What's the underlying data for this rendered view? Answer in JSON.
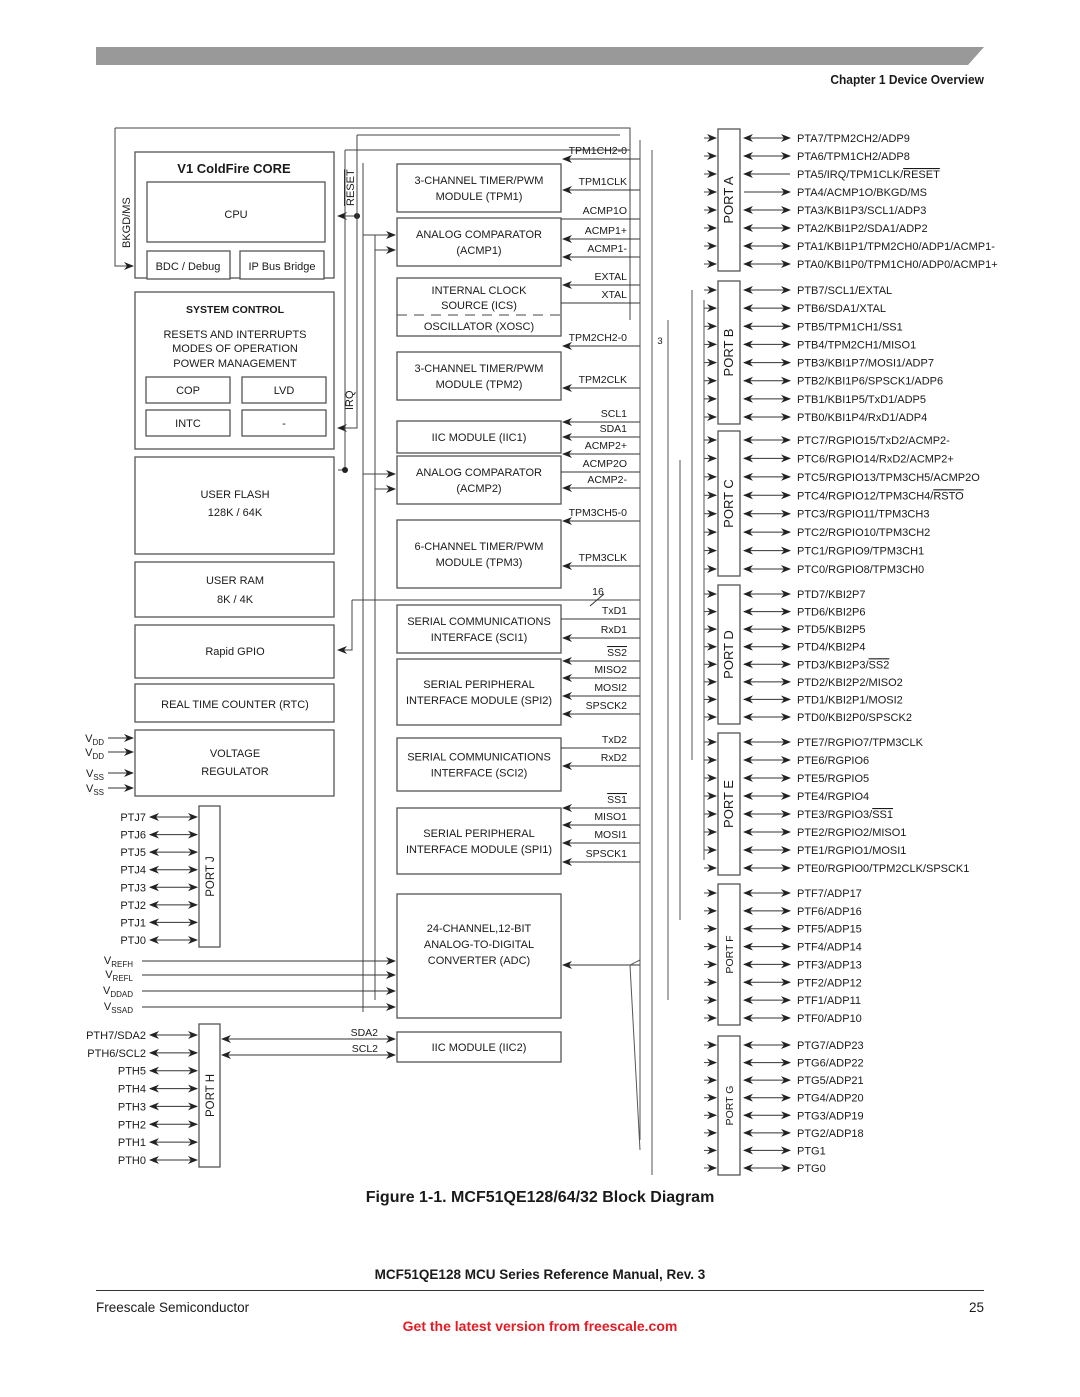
{
  "header": {
    "chapter": "Chapter 1 Device Overview"
  },
  "core": {
    "title": "V1 ColdFire CORE",
    "cpu": "CPU",
    "bdc": "BDC / Debug",
    "ip_bus": "IP Bus Bridge",
    "bkgd_signal": "BKGD/MS",
    "reset_signal": "RESET",
    "irq_signal": "IRQ"
  },
  "system_control": {
    "title": "SYSTEM CONTROL",
    "lines": [
      "RESETS AND INTERRUPTS",
      "MODES OF OPERATION",
      "POWER MANAGEMENT"
    ],
    "cop": "COP",
    "lvd": "LVD",
    "intc": "INTC",
    "blank": "-"
  },
  "memory": {
    "flash_title": "USER FLASH",
    "flash_size": "128K / 64K",
    "ram_title": "USER RAM",
    "ram_size": "8K / 4K",
    "rgpio": "Rapid GPIO",
    "rtc": "REAL TIME COUNTER (RTC)"
  },
  "regulator": {
    "line1": "VOLTAGE",
    "line2": "REGULATOR",
    "pins": [
      {
        "main": "V",
        "sub": "DD"
      },
      {
        "main": "V",
        "sub": "DD"
      },
      {
        "main": "V",
        "sub": "SS"
      },
      {
        "main": "V",
        "sub": "SS"
      }
    ]
  },
  "adc_refs": [
    {
      "main": "V",
      "sub": "REFH"
    },
    {
      "main": "V",
      "sub": "REFL"
    },
    {
      "main": "V",
      "sub": "DDAD"
    },
    {
      "main": "V",
      "sub": "SSAD"
    }
  ],
  "modules": {
    "tpm1": [
      "3-CHANNEL TIMER/PWM",
      "MODULE (TPM1)"
    ],
    "acmp1": [
      "ANALOG COMPARATOR",
      "(ACMP1)"
    ],
    "ics": [
      "INTERNAL CLOCK",
      "SOURCE (ICS)",
      "OSCILLATOR (XOSC)"
    ],
    "tpm2": [
      "3-CHANNEL TIMER/PWM",
      "MODULE (TPM2)"
    ],
    "iic1": [
      "IIC MODULE (IIC1)"
    ],
    "acmp2": [
      "ANALOG COMPARATOR",
      "(ACMP2)"
    ],
    "tpm3": [
      "6-CHANNEL TIMER/PWM",
      "MODULE (TPM3)"
    ],
    "sci1": [
      "SERIAL COMMUNICATIONS",
      "INTERFACE (SCI1)"
    ],
    "spi2": [
      "SERIAL PERIPHERAL",
      "INTERFACE MODULE (SPI2)"
    ],
    "sci2": [
      "SERIAL COMMUNICATIONS",
      "INTERFACE (SCI2)"
    ],
    "spi1": [
      "SERIAL PERIPHERAL",
      "INTERFACE MODULE (SPI1)"
    ],
    "adc": [
      "24-CHANNEL,12-BIT",
      "ANALOG-TO-DIGITAL",
      "CONVERTER (ADC)"
    ],
    "iic2": [
      "IIC MODULE (IIC2)"
    ]
  },
  "signals": {
    "tpm1": [
      "TPM1CH2-0",
      "TPM1CLK"
    ],
    "acmp1": [
      "ACMP1O",
      "ACMP1+",
      "ACMP1-"
    ],
    "ics": [
      "EXTAL",
      "XTAL"
    ],
    "tpm2": [
      "TPM2CH2-0",
      "TPM2CLK"
    ],
    "iic1": [
      "SCL1",
      "SDA1"
    ],
    "acmp2": [
      "ACMP2+",
      "ACMP2O",
      "ACMP2-"
    ],
    "tpm3": [
      "TPM3CH5-0",
      "TPM3CLK"
    ],
    "bus16": "16",
    "bus3": "3",
    "sci1": [
      "TxD1",
      "RxD1"
    ],
    "spi2": [
      "SS2",
      "MISO2",
      "MOSI2",
      "SPSCK2"
    ],
    "sci2": [
      "TxD2",
      "RxD2"
    ],
    "spi1": [
      "SS1",
      "MISO1",
      "MOSI1",
      "SPSCK1"
    ],
    "iic2": [
      "SDA2",
      "SCL2"
    ]
  },
  "ports_right": [
    {
      "name": "PORT A",
      "pins": [
        "PTA7/TPM2CH2/ADP9",
        "PTA6/TPM1CH2/ADP8",
        "PTA5/IRQ/TPM1CLK/RESET",
        "PTA4/ACMP1O/BKGD/MS",
        "PTA3/KBI1P3/SCL1/ADP3",
        "PTA2/KBI1P2/SDA1/ADP2",
        "PTA1/KBI1P1/TPM2CH0/ADP1/ACMP1-",
        "PTA0/KBI1P0/TPM1CH0/ADP0/ACMP1+"
      ]
    },
    {
      "name": "PORT B",
      "pins": [
        "PTB7/SCL1/EXTAL",
        "PTB6/SDA1/XTAL",
        "PTB5/TPM1CH1/SS1",
        "PTB4/TPM2CH1/MISO1",
        "PTB3/KBI1P7/MOSI1/ADP7",
        "PTB2/KBI1P6/SPSCK1/ADP6",
        "PTB1/KBI1P5/TxD1/ADP5",
        "PTB0/KBI1P4/RxD1/ADP4"
      ]
    },
    {
      "name": "PORT C",
      "pins": [
        "PTC7/RGPIO15/TxD2/ACMP2-",
        "PTC6/RGPIO14/RxD2/ACMP2+",
        "PTC5/RGPIO13/TPM3CH5/ACMP2O",
        "PTC4/RGPIO12/TPM3CH4/RSTO",
        "PTC3/RGPIO11/TPM3CH3",
        "PTC2/RGPIO10/TPM3CH2",
        "PTC1/RGPIO9/TPM3CH1",
        "PTC0/RGPIO8/TPM3CH0"
      ]
    },
    {
      "name": "PORT D",
      "pins": [
        "PTD7/KBI2P7",
        "PTD6/KBI2P6",
        "PTD5/KBI2P5",
        "PTD4/KBI2P4",
        "PTD3/KBI2P3/SS2",
        "PTD2/KBI2P2/MISO2",
        "PTD1/KBI2P1/MOSI2",
        "PTD0/KBI2P0/SPSCK2"
      ]
    },
    {
      "name": "PORT E",
      "pins": [
        "PTE7/RGPIO7/TPM3CLK",
        "PTE6/RGPIO6",
        "PTE5/RGPIO5",
        "PTE4/RGPIO4",
        "PTE3/RGPIO3/SS1",
        "PTE2/RGPIO2/MISO1",
        "PTE1/RGPIO1/MOSI1",
        "PTE0/RGPIO0/TPM2CLK/SPSCK1"
      ]
    },
    {
      "name": "PORT F",
      "pins": [
        "PTF7/ADP17",
        "PTF6/ADP16",
        "PTF5/ADP15",
        "PTF4/ADP14",
        "PTF3/ADP13",
        "PTF2/ADP12",
        "PTF1/ADP11",
        "PTF0/ADP10"
      ]
    },
    {
      "name": "PORT G",
      "pins": [
        "PTG7/ADP23",
        "PTG6/ADP22",
        "PTG5/ADP21",
        "PTG4/ADP20",
        "PTG3/ADP19",
        "PTG2/ADP18",
        "PTG1",
        "PTG0"
      ]
    }
  ],
  "ports_left": [
    {
      "name": "PORT J",
      "pins": [
        "PTJ7",
        "PTJ6",
        "PTJ5",
        "PTJ4",
        "PTJ3",
        "PTJ2",
        "PTJ1",
        "PTJ0"
      ]
    },
    {
      "name": "PORT H",
      "pins": [
        "PTH7/SDA2",
        "PTH6/SCL2",
        "PTH5",
        "PTH4",
        "PTH3",
        "PTH2",
        "PTH1",
        "PTH0"
      ]
    }
  ],
  "figure": {
    "caption": "Figure 1-1. MCF51QE128/64/32 Block Diagram"
  },
  "footer": {
    "manual_title": "MCF51QE128 MCU Series Reference Manual, Rev. 3",
    "company": "Freescale Semiconductor",
    "page_number": "25",
    "link_text": "Get the latest version from freescale.com"
  },
  "colors": {
    "header_bar": "#999999",
    "link": "#e31b23"
  }
}
